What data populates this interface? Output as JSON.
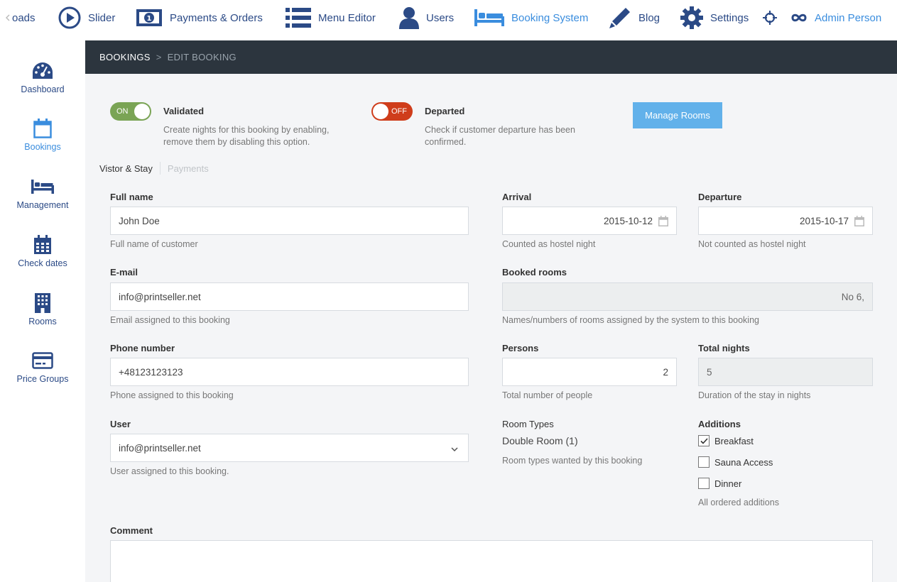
{
  "topnav": {
    "items": [
      {
        "label": "oads",
        "icon": "downloads-icon"
      },
      {
        "label": "Slider",
        "icon": "play-circle-icon"
      },
      {
        "label": "Payments & Orders",
        "icon": "banknote-icon"
      },
      {
        "label": "Menu Editor",
        "icon": "list-icon"
      },
      {
        "label": "Users",
        "icon": "user-icon"
      },
      {
        "label": "Booking System",
        "icon": "bed-icon"
      },
      {
        "label": "Blog",
        "icon": "pencil-icon"
      },
      {
        "label": "Settings",
        "icon": "gear-icon"
      },
      {
        "label": "",
        "icon": "crosshair-icon"
      },
      {
        "label": "Admin Person",
        "icon": "infinity-icon"
      }
    ],
    "active": "Booking System"
  },
  "sidebar": {
    "items": [
      {
        "label": "Dashboard",
        "icon": "dashboard-icon"
      },
      {
        "label": "Bookings",
        "icon": "calendar-icon"
      },
      {
        "label": "Management",
        "icon": "bed-icon"
      },
      {
        "label": "Check dates",
        "icon": "calendar-grid-icon"
      },
      {
        "label": "Rooms",
        "icon": "building-icon"
      },
      {
        "label": "Price Groups",
        "icon": "credit-card-icon"
      }
    ],
    "active": "Bookings"
  },
  "breadcrumb": {
    "root": "BOOKINGS",
    "separator": ">",
    "current": "EDIT BOOKING"
  },
  "toggles": {
    "validated": {
      "state": "ON",
      "title": "Validated",
      "desc_line1": "Create nights for this booking by enabling,",
      "desc_line2": "remove them by disabling this option.",
      "color": "#7aa455"
    },
    "departed": {
      "state": "OFF",
      "title": "Departed",
      "desc_line1": "Check if customer departure has been",
      "desc_line2": "confirmed.",
      "color": "#cf3d1b"
    }
  },
  "manage_rooms_label": "Manage Rooms",
  "tabs": [
    {
      "label": "Vistor & Stay",
      "active": true
    },
    {
      "label": "Payments",
      "active": false
    }
  ],
  "form": {
    "full_name": {
      "label": "Full name",
      "value": "John Doe",
      "help": "Full name of customer"
    },
    "arrival": {
      "label": "Arrival",
      "value": "2015-10-12",
      "help": "Counted as hostel night"
    },
    "departure": {
      "label": "Departure",
      "value": "2015-10-17",
      "help": "Not counted as hostel night"
    },
    "email": {
      "label": "E-mail",
      "value": "info@printseller.net",
      "help": "Email assigned to this booking"
    },
    "booked_rooms": {
      "label": "Booked rooms",
      "value": "No 6,",
      "help": "Names/numbers of rooms assigned by the system to this booking"
    },
    "phone": {
      "label": "Phone number",
      "value": "+48123123123",
      "help": "Phone assigned to this booking"
    },
    "persons": {
      "label": "Persons",
      "value": "2",
      "help": "Total number of people"
    },
    "total_nights": {
      "label": "Total nights",
      "value": "5",
      "help": "Duration of the stay in nights"
    },
    "user": {
      "label": "User",
      "value": "info@printseller.net",
      "help": "User assigned to this booking."
    },
    "room_types": {
      "label": "Room Types",
      "value": "Double Room (1)",
      "help": "Room types wanted by this booking"
    },
    "additions": {
      "label": "Additions",
      "items": [
        {
          "label": "Breakfast",
          "checked": true
        },
        {
          "label": "Sauna Access",
          "checked": false
        },
        {
          "label": "Dinner",
          "checked": false
        }
      ],
      "help": "All ordered additions"
    },
    "comment": {
      "label": "Comment",
      "value": ""
    }
  },
  "colors": {
    "brand": "#2b4a86",
    "active": "#3a8dde",
    "header": "#2c353e",
    "button": "#62b1ea"
  }
}
